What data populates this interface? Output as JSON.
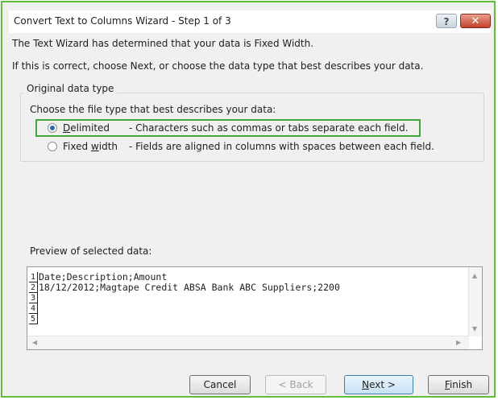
{
  "window": {
    "title": "Convert Text to Columns Wizard - Step 1 of 3",
    "help_label": "?",
    "close_label": "✕"
  },
  "intro": {
    "line1": "The Text Wizard has determined that your data is Fixed Width.",
    "line2": "If this is correct, choose Next, or choose the data type that best describes your data."
  },
  "original_data_type": {
    "legend": "Original data type",
    "prompt": "Choose the file type that best describes your data:",
    "options": [
      {
        "label_underlined": "D",
        "label_rest": "elimited",
        "description": "- Characters such as commas or tabs separate each field.",
        "selected": true
      },
      {
        "label_prefix": "Fixed ",
        "label_underlined": "w",
        "label_rest": "idth",
        "description": "- Fields are aligned in columns with spaces between each field.",
        "selected": false
      }
    ]
  },
  "preview": {
    "label": "Preview of selected data:",
    "rows": [
      {
        "num": "1",
        "text": "Date;Description;Amount"
      },
      {
        "num": "2",
        "text": "18/12/2012;Magtape Credit ABSA Bank ABC Suppliers;2200"
      },
      {
        "num": "3",
        "text": ""
      },
      {
        "num": "4",
        "text": ""
      },
      {
        "num": "5",
        "text": ""
      }
    ]
  },
  "buttons": {
    "cancel": "Cancel",
    "back": "< Back",
    "next_underlined": "N",
    "next_rest": "ext >",
    "finish_underlined": "F",
    "finish_rest": "inish"
  },
  "colors": {
    "highlight_border": "#3ea83a",
    "frame_border": "#5fbf3a",
    "close_button": "#c2412c",
    "radio_selected": "#2d63b8"
  }
}
